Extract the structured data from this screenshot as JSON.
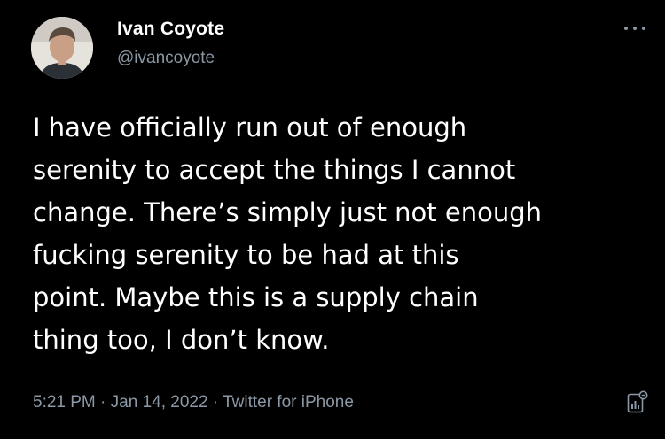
{
  "author": {
    "name": "Ivan Coyote",
    "handle": "@ivancoyote",
    "avatar_icon": "profile-photo"
  },
  "tweet": {
    "lines": [
      "I have officially run out of enough",
      "serenity to accept the things I cannot",
      "change. There’s simply just not enough",
      "fucking serenity to be had at this",
      "point. Maybe this is a supply chain",
      "thing too, I don’t know."
    ]
  },
  "meta": {
    "time": "5:21 PM",
    "separator": " · ",
    "date": "Jan 14, 2022",
    "source": "Twitter for iPhone"
  },
  "icons": {
    "more": "more-options-icon",
    "analytics": "analytics-icon"
  },
  "colors": {
    "background": "#000000",
    "text": "#ffffff",
    "secondary": "#8b98a5"
  }
}
